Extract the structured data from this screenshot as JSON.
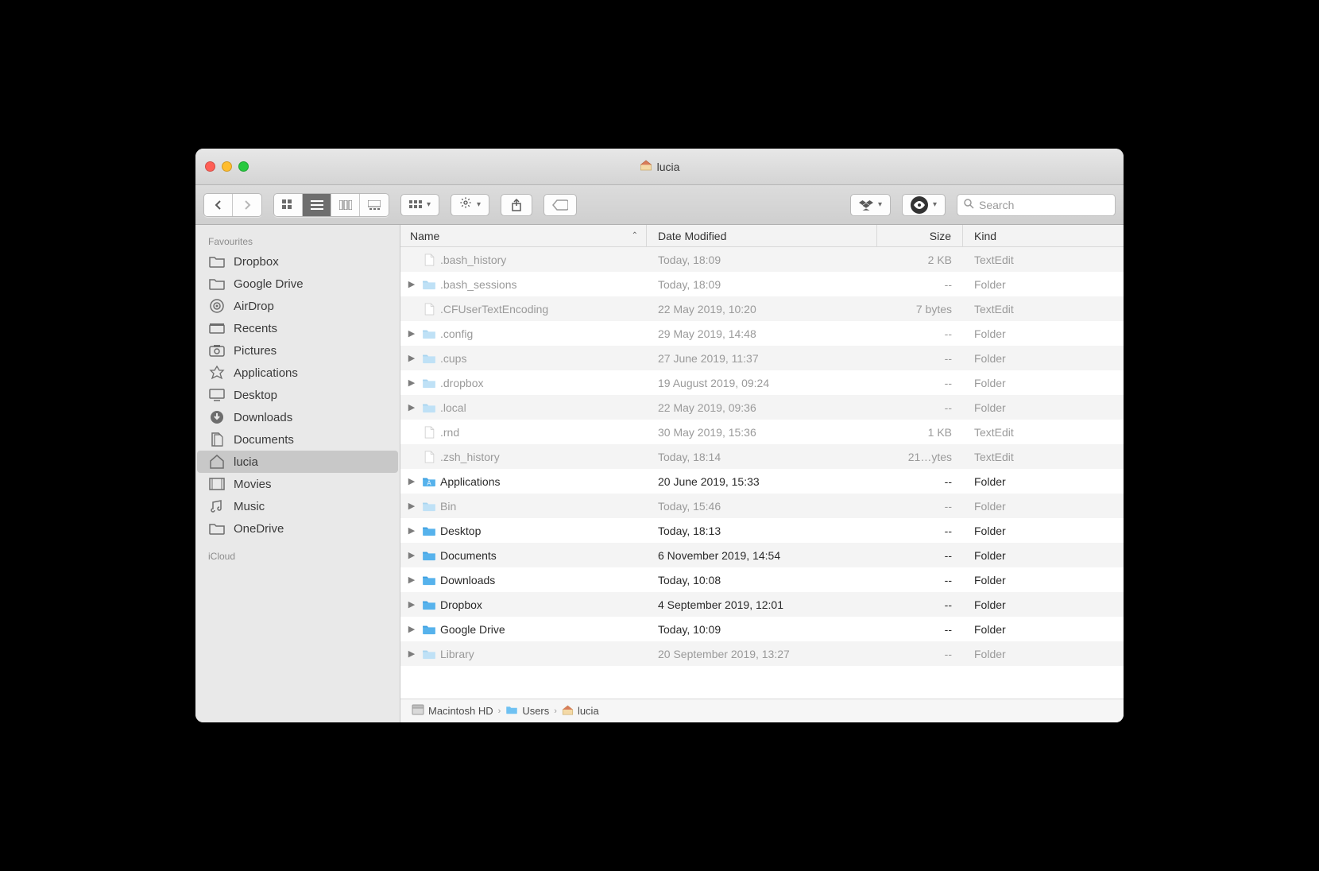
{
  "window": {
    "title": "lucia"
  },
  "toolbar": {
    "search_placeholder": "Search"
  },
  "sidebar": {
    "sections": [
      {
        "label": "Favourites",
        "items": [
          {
            "label": "Dropbox",
            "icon": "folder"
          },
          {
            "label": "Google Drive",
            "icon": "folder"
          },
          {
            "label": "AirDrop",
            "icon": "airdrop"
          },
          {
            "label": "Recents",
            "icon": "recents"
          },
          {
            "label": "Pictures",
            "icon": "pictures"
          },
          {
            "label": "Applications",
            "icon": "apps"
          },
          {
            "label": "Desktop",
            "icon": "desktop"
          },
          {
            "label": "Downloads",
            "icon": "downloads"
          },
          {
            "label": "Documents",
            "icon": "documents"
          },
          {
            "label": "lucia",
            "icon": "home",
            "selected": true
          },
          {
            "label": "Movies",
            "icon": "movies"
          },
          {
            "label": "Music",
            "icon": "music"
          },
          {
            "label": "OneDrive",
            "icon": "folder"
          }
        ]
      },
      {
        "label": "iCloud",
        "items": []
      }
    ]
  },
  "columns": {
    "name": "Name",
    "date": "Date Modified",
    "size": "Size",
    "kind": "Kind"
  },
  "rows": [
    {
      "name": ".bash_history",
      "date": "Today, 18:09",
      "size": "2 KB",
      "kind": "TextEdit",
      "type": "file",
      "dim": true
    },
    {
      "name": ".bash_sessions",
      "date": "Today, 18:09",
      "size": "--",
      "kind": "Folder",
      "type": "folder",
      "dim": true
    },
    {
      "name": ".CFUserTextEncoding",
      "date": "22 May 2019, 10:20",
      "size": "7 bytes",
      "kind": "TextEdit",
      "type": "file",
      "dim": true
    },
    {
      "name": ".config",
      "date": "29 May 2019, 14:48",
      "size": "--",
      "kind": "Folder",
      "type": "folder",
      "dim": true
    },
    {
      "name": ".cups",
      "date": "27 June 2019, 11:37",
      "size": "--",
      "kind": "Folder",
      "type": "folder",
      "dim": true
    },
    {
      "name": ".dropbox",
      "date": "19 August 2019, 09:24",
      "size": "--",
      "kind": "Folder",
      "type": "folder",
      "dim": true
    },
    {
      "name": ".local",
      "date": "22 May 2019, 09:36",
      "size": "--",
      "kind": "Folder",
      "type": "folder",
      "dim": true
    },
    {
      "name": ".rnd",
      "date": "30 May 2019, 15:36",
      "size": "1 KB",
      "kind": "TextEdit",
      "type": "file",
      "dim": true
    },
    {
      "name": ".zsh_history",
      "date": "Today, 18:14",
      "size": "21…ytes",
      "kind": "TextEdit",
      "type": "file",
      "dim": true
    },
    {
      "name": "Applications",
      "date": "20 June 2019, 15:33",
      "size": "--",
      "kind": "Folder",
      "type": "folder",
      "dim": false,
      "apps": true
    },
    {
      "name": "Bin",
      "date": "Today, 15:46",
      "size": "--",
      "kind": "Folder",
      "type": "folder",
      "dim": true
    },
    {
      "name": "Desktop",
      "date": "Today, 18:13",
      "size": "--",
      "kind": "Folder",
      "type": "folder",
      "dim": false
    },
    {
      "name": "Documents",
      "date": "6 November 2019, 14:54",
      "size": "--",
      "kind": "Folder",
      "type": "folder",
      "dim": false
    },
    {
      "name": "Downloads",
      "date": "Today, 10:08",
      "size": "--",
      "kind": "Folder",
      "type": "folder",
      "dim": false
    },
    {
      "name": "Dropbox",
      "date": "4 September 2019, 12:01",
      "size": "--",
      "kind": "Folder",
      "type": "folder",
      "dim": false
    },
    {
      "name": "Google Drive",
      "date": "Today, 10:09",
      "size": "--",
      "kind": "Folder",
      "type": "folder",
      "dim": false
    },
    {
      "name": "Library",
      "date": "20 September 2019, 13:27",
      "size": "--",
      "kind": "Folder",
      "type": "folder",
      "dim": true
    }
  ],
  "path": [
    {
      "label": "Macintosh HD",
      "icon": "drive"
    },
    {
      "label": "Users",
      "icon": "folder"
    },
    {
      "label": "lucia",
      "icon": "home"
    }
  ]
}
